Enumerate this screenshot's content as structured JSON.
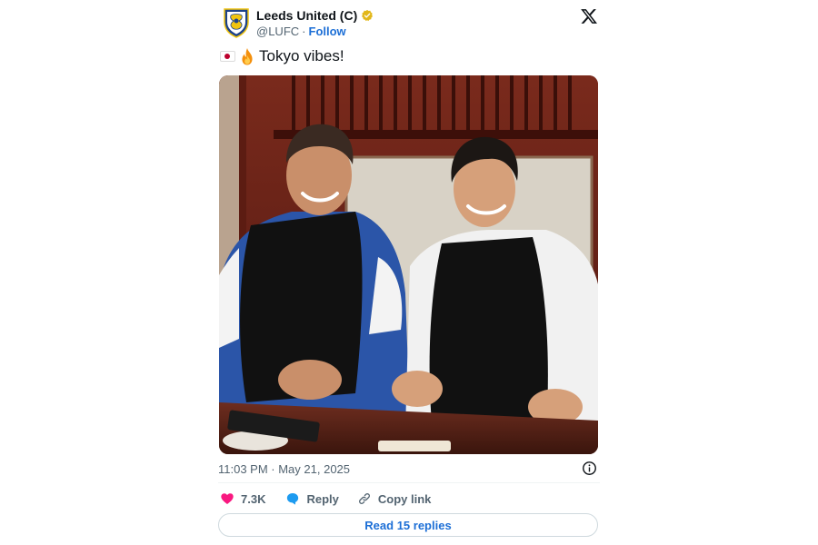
{
  "account": {
    "name": "Leeds United (C)",
    "handle": "@LUFC",
    "separator": "·",
    "follow_label": "Follow"
  },
  "tweet": {
    "text": "Tokyo vibes!",
    "emoji": [
      "japan-flag",
      "fire"
    ],
    "photo_alt": "Two players in black aprons smiling at a restaurant table",
    "timestamp": "11:03 PM · May 21, 2025"
  },
  "actions": {
    "like_count": "7.3K",
    "reply_label": "Reply",
    "copy_link_label": "Copy link"
  },
  "footer": {
    "read_replies_label": "Read 15 replies"
  },
  "colors": {
    "accent": "#1d6fd6",
    "like": "#f91880",
    "reply": "#1d9bf0",
    "verified": "#e2b719",
    "text_secondary": "#536471"
  },
  "icons": {
    "brand": "x-logo-icon",
    "verified": "verified-badge-icon",
    "info": "info-icon",
    "like": "heart-icon",
    "reply": "reply-bubble-icon",
    "copy_link": "link-icon"
  }
}
